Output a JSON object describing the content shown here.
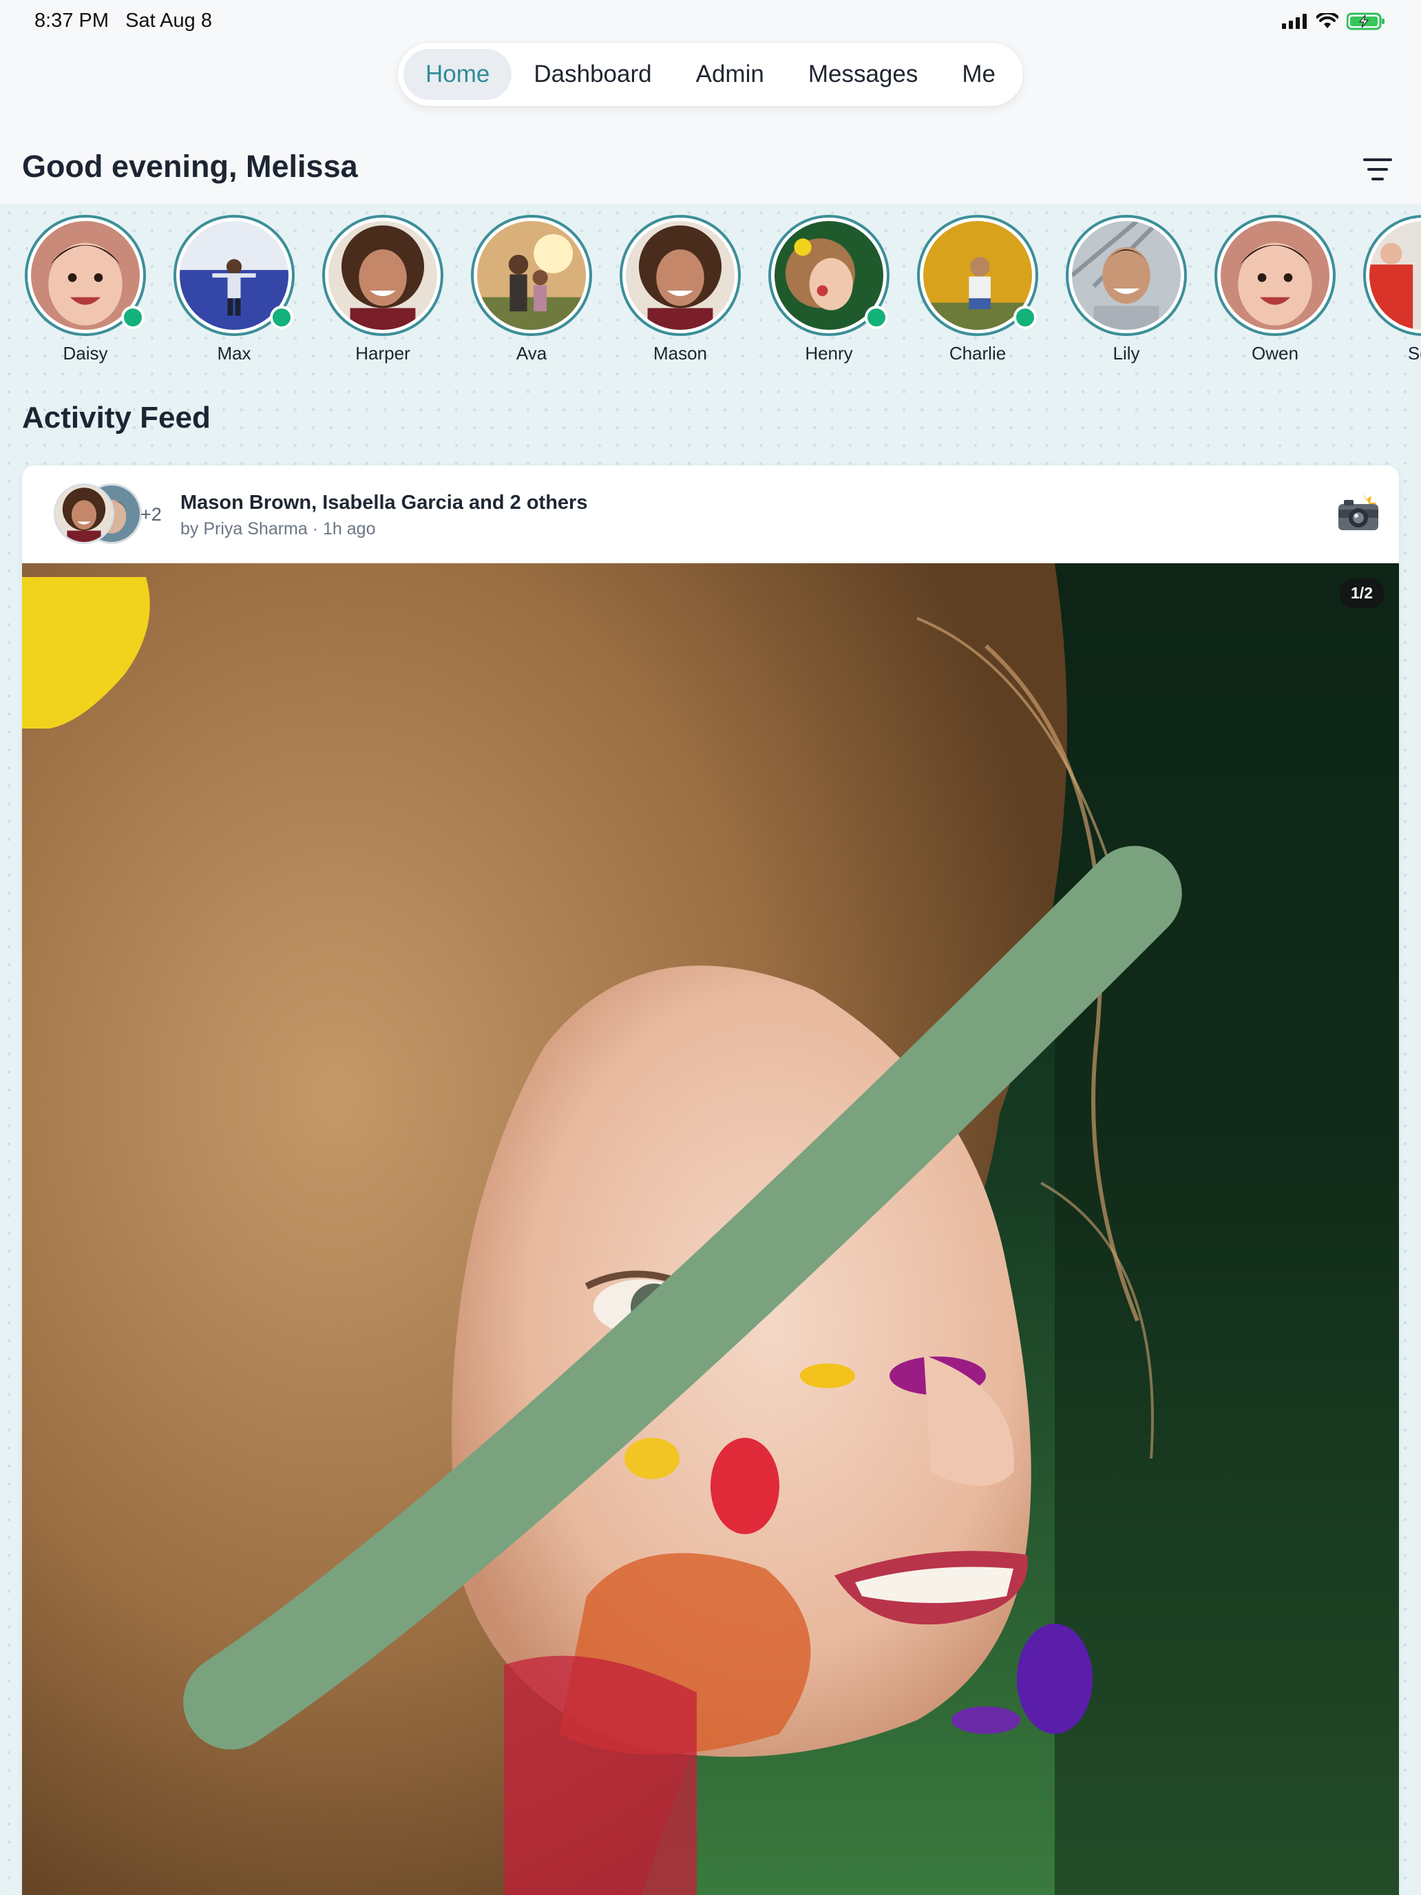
{
  "status": {
    "time": "8:37 PM",
    "date": "Sat Aug 8",
    "icons": [
      "cellular-signal-icon",
      "wifi-icon",
      "battery-charging-icon"
    ]
  },
  "nav": {
    "tabs": [
      {
        "label": "Home",
        "active": true
      },
      {
        "label": "Dashboard",
        "active": false
      },
      {
        "label": "Admin",
        "active": false
      },
      {
        "label": "Messages",
        "active": false
      },
      {
        "label": "Me",
        "active": false
      }
    ]
  },
  "greeting": "Good evening, Melissa",
  "stories": [
    {
      "name": "Daisy",
      "online": true
    },
    {
      "name": "Max",
      "online": true
    },
    {
      "name": "Harper",
      "online": false
    },
    {
      "name": "Ava",
      "online": false
    },
    {
      "name": "Mason",
      "online": false
    },
    {
      "name": "Henry",
      "online": true
    },
    {
      "name": "Charlie",
      "online": true
    },
    {
      "name": "Lily",
      "online": false
    },
    {
      "name": "Owen",
      "online": false
    },
    {
      "name": "Sop",
      "online": false
    }
  ],
  "feed": {
    "title": "Activity Feed",
    "posts": [
      {
        "title": "Mason Brown, Isabella Garcia and 2 others",
        "author": "by Priya Sharma",
        "time": "1h ago",
        "extra_count": "+2",
        "counter": "1/2",
        "type_icon": "camera-flash-icon"
      }
    ]
  },
  "colors": {
    "accent": "#2f8c98",
    "ring": "#3d8f98",
    "online": "#13b27a",
    "band": "#e7f2f5"
  }
}
